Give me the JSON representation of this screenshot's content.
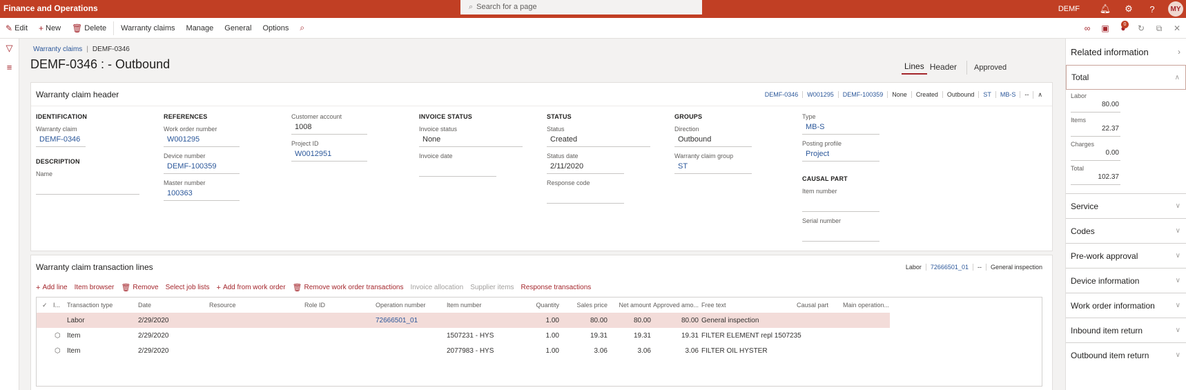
{
  "topbar": {
    "app_title": "Finance and Operations",
    "search_placeholder": "Search for a page",
    "company": "DEMF",
    "user_initials": "MY"
  },
  "actionbar": {
    "edit": "Edit",
    "new": "New",
    "delete": "Delete",
    "tabs": [
      "Warranty claims",
      "Manage",
      "General",
      "Options"
    ],
    "notification_count": "0"
  },
  "breadcrumb": {
    "parent": "Warranty claims",
    "current": "DEMF-0346"
  },
  "page_title": "DEMF-0346 : - Outbound",
  "view_tabs": {
    "lines": "Lines",
    "header": "Header",
    "status": "Approved"
  },
  "header_card": {
    "title": "Warranty claim header",
    "summary": [
      {
        "text": "DEMF-0346",
        "link": true
      },
      {
        "text": "W001295",
        "link": true
      },
      {
        "text": "DEMF-100359",
        "link": true
      },
      {
        "text": "None",
        "link": false
      },
      {
        "text": "Created",
        "link": false
      },
      {
        "text": "Outbound",
        "link": false
      },
      {
        "text": "ST",
        "link": true
      },
      {
        "text": "MB-S",
        "link": true
      },
      {
        "text": "--",
        "link": false
      }
    ],
    "identification": {
      "title": "IDENTIFICATION",
      "warranty_claim_label": "Warranty claim",
      "warranty_claim_value": "DEMF-0346"
    },
    "description": {
      "title": "DESCRIPTION",
      "name_label": "Name",
      "name_value": ""
    },
    "references": {
      "title": "REFERENCES",
      "work_order_label": "Work order number",
      "work_order_value": "W001295",
      "device_label": "Device number",
      "device_value": "DEMF-100359",
      "master_label": "Master number",
      "master_value": "100363"
    },
    "customer": {
      "account_label": "Customer account",
      "account_value": "1008",
      "project_label": "Project ID",
      "project_value": "W0012951"
    },
    "invoice_status": {
      "title": "INVOICE STATUS",
      "status_label": "Invoice status",
      "status_value": "None",
      "date_label": "Invoice date",
      "date_value": ""
    },
    "status": {
      "title": "STATUS",
      "status_label": "Status",
      "status_value": "Created",
      "date_label": "Status date",
      "date_value": "2/11/2020",
      "response_label": "Response code",
      "response_value": ""
    },
    "groups": {
      "title": "GROUPS",
      "direction_label": "Direction",
      "direction_value": "Outbound",
      "group_label": "Warranty claim group",
      "group_value": "ST"
    },
    "type_block": {
      "type_label": "Type",
      "type_value": "MB-S",
      "posting_label": "Posting profile",
      "posting_value": "Project"
    },
    "causal_part": {
      "title": "CAUSAL PART",
      "item_label": "Item number",
      "item_value": "",
      "serial_label": "Serial number",
      "serial_value": ""
    }
  },
  "lines_card": {
    "title": "Warranty claim transaction lines",
    "summary": [
      {
        "text": "Labor",
        "link": false
      },
      {
        "text": "72666501_01",
        "link": true
      },
      {
        "text": "--",
        "link": false
      },
      {
        "text": "General inspection",
        "link": false
      }
    ],
    "toolbar": [
      {
        "label": "Add line",
        "icon": "plus",
        "disabled": false
      },
      {
        "label": "Item browser",
        "icon": "",
        "disabled": false
      },
      {
        "label": "Remove",
        "icon": "trash",
        "disabled": false
      },
      {
        "label": "Select job lists",
        "icon": "",
        "disabled": false
      },
      {
        "label": "Add from work order",
        "icon": "plus",
        "disabled": false
      },
      {
        "label": "Remove work order transactions",
        "icon": "trash",
        "disabled": false
      },
      {
        "label": "Invoice allocation",
        "icon": "",
        "disabled": true
      },
      {
        "label": "Supplier items",
        "icon": "",
        "disabled": true
      },
      {
        "label": "Response transactions",
        "icon": "",
        "disabled": false
      }
    ],
    "columns": [
      "I...",
      "Transaction type",
      "Date",
      "Resource",
      "Role ID",
      "Operation number",
      "Item number",
      "Quantity",
      "Sales price",
      "Net amount",
      "Approved amo...",
      "Free text",
      "Causal part",
      "Main operation..."
    ],
    "rows": [
      {
        "icon": "",
        "type": "Labor",
        "date": "2/29/2020",
        "resource": "",
        "role": "",
        "operation": "72666501_01",
        "item": "",
        "qty": "1.00",
        "price": "80.00",
        "net": "80.00",
        "approved": "80.00",
        "free_text": "General inspection",
        "causal": "",
        "main_op": "",
        "selected": true
      },
      {
        "icon": "item",
        "type": "Item",
        "date": "2/29/2020",
        "resource": "",
        "role": "",
        "operation": "",
        "item": "1507231 - HYS",
        "qty": "1.00",
        "price": "19.31",
        "net": "19.31",
        "approved": "19.31",
        "free_text": "FILTER ELEMENT repl 1507235",
        "causal": "",
        "main_op": "",
        "selected": false
      },
      {
        "icon": "item",
        "type": "Item",
        "date": "2/29/2020",
        "resource": "",
        "role": "",
        "operation": "",
        "item": "2077983 - HYS",
        "qty": "1.00",
        "price": "3.06",
        "net": "3.06",
        "approved": "3.06",
        "free_text": "FILTER OIL HYSTER",
        "causal": "",
        "main_op": "",
        "selected": false
      }
    ]
  },
  "related_info": {
    "title": "Related information",
    "total_section": {
      "title": "Total",
      "labor_label": "Labor",
      "labor_value": "80.00",
      "items_label": "Items",
      "items_value": "22.37",
      "charges_label": "Charges",
      "charges_value": "0.00",
      "total_label": "Total",
      "total_value": "102.37"
    },
    "sections": [
      "Service",
      "Codes",
      "Pre-work approval",
      "Device information",
      "Work order information",
      "Inbound item return",
      "Outbound item return"
    ]
  },
  "colors": {
    "brand": "#c13f24",
    "accent": "#a4262c",
    "link": "#2b579a",
    "selected_row": "#f3dcd9"
  }
}
